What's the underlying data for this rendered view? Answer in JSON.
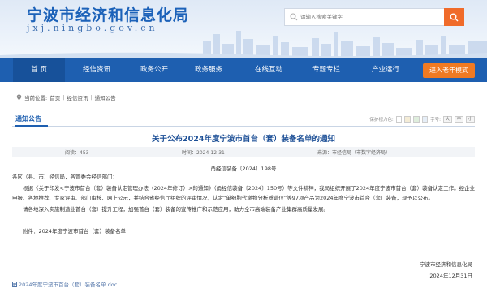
{
  "header": {
    "site_title": "宁波市经济和信息化局",
    "site_domain": "jxj.ningbo.gov.cn",
    "search_placeholder": "请输入搜索关键字"
  },
  "nav": {
    "items": [
      "首 页",
      "经信资讯",
      "政务公开",
      "政务服务",
      "在线互动",
      "专题专栏",
      "产业运行"
    ],
    "active_index": 0,
    "old_mode_label": "进入老年模式"
  },
  "breadcrumb": {
    "prefix": "当前位置:",
    "items": [
      "首页",
      "经信资讯",
      "通知公告"
    ]
  },
  "tab": {
    "label": "通知公告",
    "tools_prefix": "保护视力色:",
    "font_label": "字号:",
    "font_sizes": [
      "大",
      "中",
      "小"
    ]
  },
  "article": {
    "title": "关于公布2024年度宁波市首台（套）装备名单的通知",
    "meta_views": "阅读：453",
    "meta_date": "时间：2024-12-31",
    "meta_source": "来源：市经信局（市数字经济局）",
    "doc_number": "甬经信装备〔2024〕198号",
    "salutation": "各区（县、市）经信局，各管委会经信部门：",
    "para1": "根据《关于印发<宁波市首台（套）装备认定管理办法（2024年修订）>的通知》（甬经信装备〔2024〕150号）等文件精神，我局组织开展了2024年度宁波市首台（套）装备认定工作。经企业申报、各地推荐、专家评审、部门审核、网上公示，并结合省经信厅组织的评审情况，认定“单细胞代谢物分析质谱仪”等97项产品为2024年度宁波市首台（套）装备，现予以公布。",
    "para2": "请各地深入实施制造业首台（套）提升工程，加强首台（套）装备的宣传推广和示范应用，助力全市高端装备产业集群高质量发展。",
    "attachment_note": "附件：2024年度宁波市首台（套）装备名单",
    "signature_org": "宁波市经济和信息化局",
    "signature_date": "2024年12月31日",
    "attachment_file": "2024年度宁波市首台（套）装备名单.doc"
  },
  "colors": {
    "nav_bg": "#1e5fb0",
    "accent_orange": "#f07a22",
    "title_blue": "#1c4f96"
  }
}
